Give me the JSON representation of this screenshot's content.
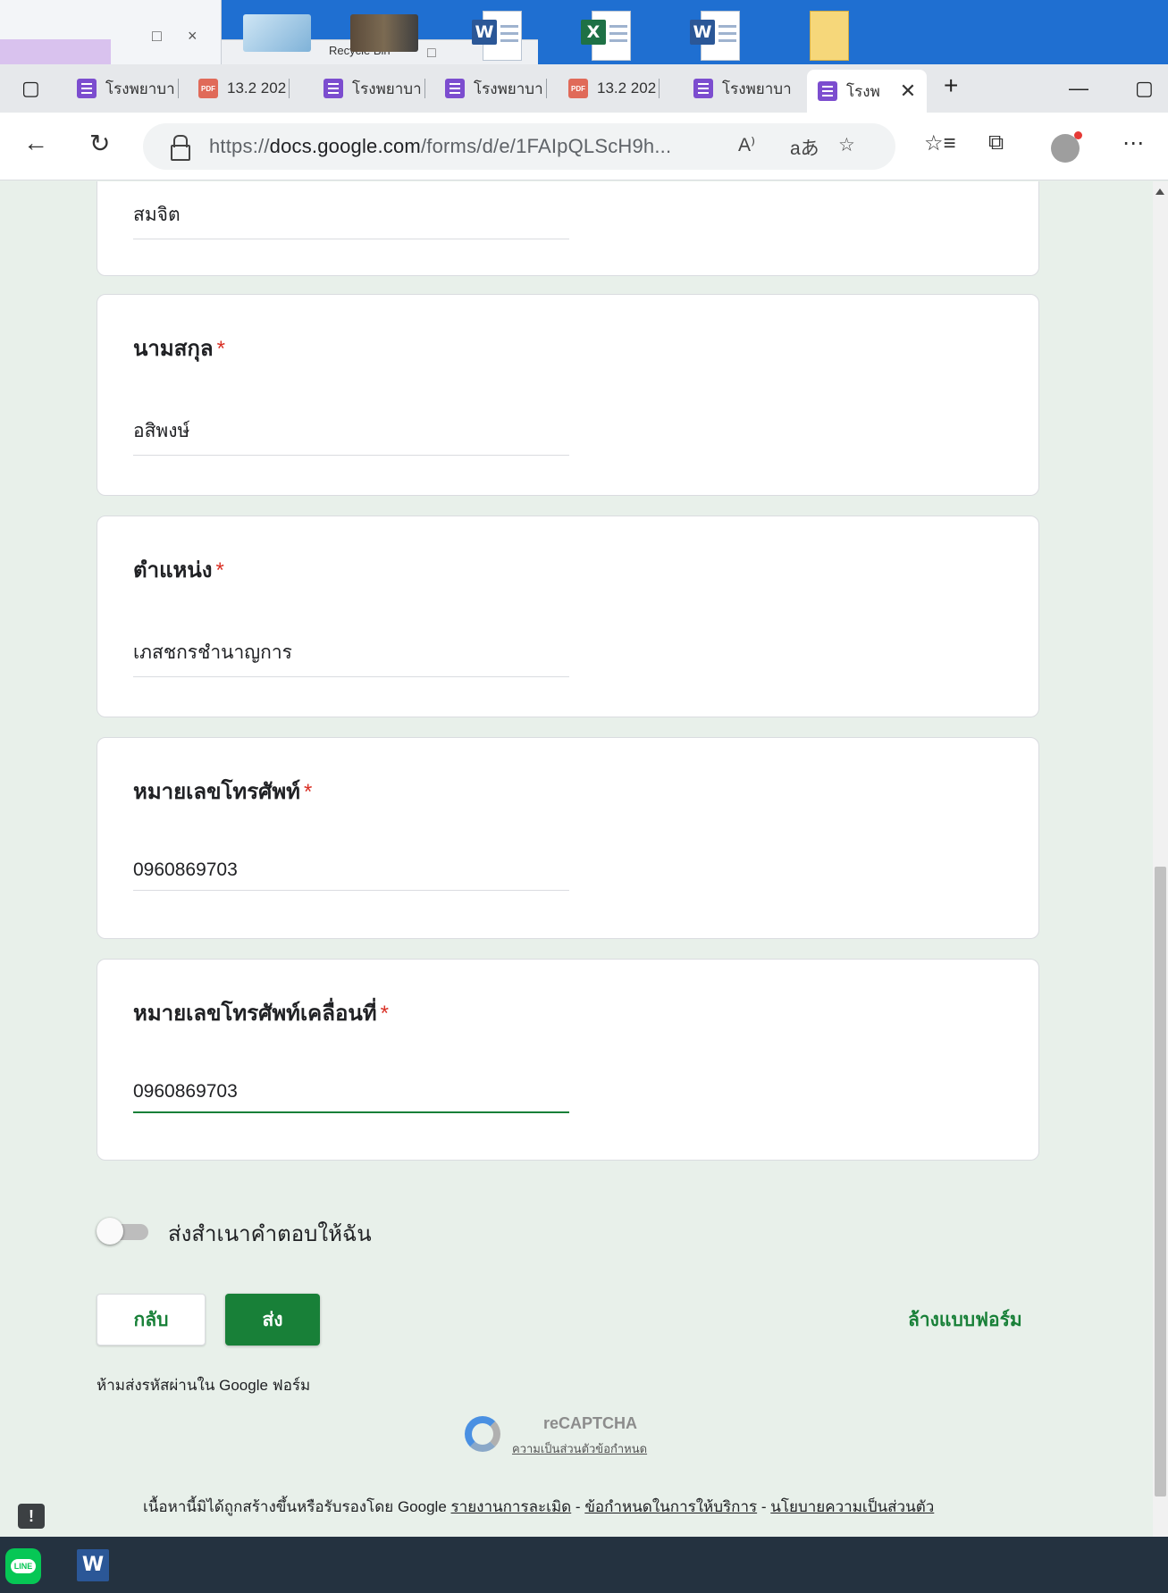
{
  "taskbar": {
    "recycle_bin_label": "Recycle Bin"
  },
  "browser": {
    "tabs": [
      {
        "label": "โรงพยาบา",
        "icon": "forms-icon"
      },
      {
        "label": "13.2 202",
        "icon": "pdf-icon"
      },
      {
        "label": "โรงพยาบา",
        "icon": "forms-icon"
      },
      {
        "label": "โรงพยาบา",
        "icon": "forms-icon"
      },
      {
        "label": "13.2 202",
        "icon": "pdf-icon"
      },
      {
        "label": "โรงพยาบา",
        "icon": "forms-icon"
      },
      {
        "label": "โรงพ",
        "icon": "forms-icon",
        "active": true
      }
    ],
    "url_prefix": "https://",
    "url_host": "docs.google.com",
    "url_path": "/forms/d/e/1FAIpQLScH9h..."
  },
  "form": {
    "prev_answer": "สมจิต",
    "questions": [
      {
        "title": "นามสกุล",
        "required_mark": "*",
        "answer": "อสิพงษ์"
      },
      {
        "title": "ตำแหน่ง",
        "required_mark": "*",
        "answer": "เภสชกรชำนาญการ"
      },
      {
        "title": "หมายเลขโทรศัพท์",
        "required_mark": "*",
        "answer": "0960869703"
      },
      {
        "title": "หมายเลขโทรศัพท์เคลื่อนที่",
        "required_mark": "*",
        "answer": "0960869703"
      }
    ],
    "copy_toggle_label": "ส่งสำเนาคำตอบให้ฉัน",
    "back_button": "กลับ",
    "submit_button": "ส่ง",
    "clear_form_link": "ล้างแบบฟอร์ม",
    "password_note": "ห้ามส่งรหัสผ่านใน Google ฟอร์ม",
    "recaptcha_name": "reCAPTCHA",
    "recaptcha_privacy": "ความเป็นส่วนตัวข้อกำหนด",
    "footer_text": "เนื้อหานี้มิได้ถูกสร้างขึ้นหรือรับรองโดย Google",
    "footer_links": [
      "รายงานการละเมิด",
      "ข้อกำหนดในการให้บริการ",
      "นโยบายความเป็นส่วนตัว"
    ],
    "footer_sep": " - "
  },
  "colors": {
    "accent": "#188038",
    "required": "#d93025",
    "page_bg": "#e8f0ea"
  }
}
